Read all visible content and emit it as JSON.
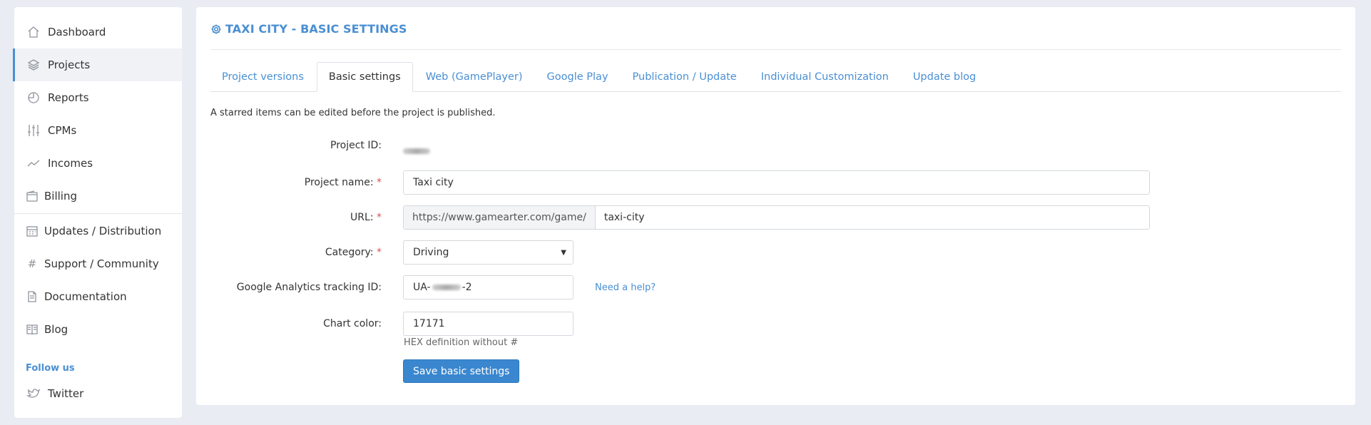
{
  "sidebar": {
    "items": [
      {
        "label": "Dashboard",
        "icon": "home-icon"
      },
      {
        "label": "Projects",
        "icon": "layers-icon",
        "active": true
      },
      {
        "label": "Reports",
        "icon": "pie-chart-icon"
      },
      {
        "label": "CPMs",
        "icon": "sliders-icon"
      },
      {
        "label": "Incomes",
        "icon": "trend-icon"
      },
      {
        "label": "Billing",
        "icon": "wallet-icon"
      },
      {
        "label": "Updates / Distribution",
        "icon": "calendar-icon"
      },
      {
        "label": "Support / Community",
        "icon": "hash-icon"
      },
      {
        "label": "Documentation",
        "icon": "document-icon"
      },
      {
        "label": "Blog",
        "icon": "book-icon"
      }
    ],
    "follow_label": "Follow us",
    "social": [
      {
        "label": "Twitter",
        "icon": "twitter-icon"
      }
    ]
  },
  "main": {
    "title": "TAXI CITY - BASIC SETTINGS",
    "tabs": [
      {
        "label": "Project versions"
      },
      {
        "label": "Basic settings",
        "active": true
      },
      {
        "label": "Web (GamePlayer)"
      },
      {
        "label": "Google Play"
      },
      {
        "label": "Publication / Update"
      },
      {
        "label": "Individual Customization"
      },
      {
        "label": "Update blog"
      }
    ],
    "note": "A starred items can be edited before the project is published.",
    "form": {
      "project_id_label": "Project ID:",
      "project_name_label": "Project name:",
      "project_name_value": "Taxi city",
      "url_label": "URL:",
      "url_prefix": "https://www.gamearter.com/game/",
      "url_value": "taxi-city",
      "category_label": "Category:",
      "category_value": "Driving",
      "ga_label": "Google Analytics tracking ID:",
      "ga_prefix": "UA-",
      "ga_suffix": "-2",
      "help_link": "Need a help?",
      "chart_color_label": "Chart color:",
      "chart_color_value": "17171",
      "chart_color_hint": "HEX definition without #",
      "save_button": "Save basic settings",
      "required_mark": "*"
    }
  },
  "colors": {
    "accent": "#4a8fd3",
    "button": "#3a87cf",
    "required": "#d9534f",
    "background": "#e9ecf3"
  }
}
